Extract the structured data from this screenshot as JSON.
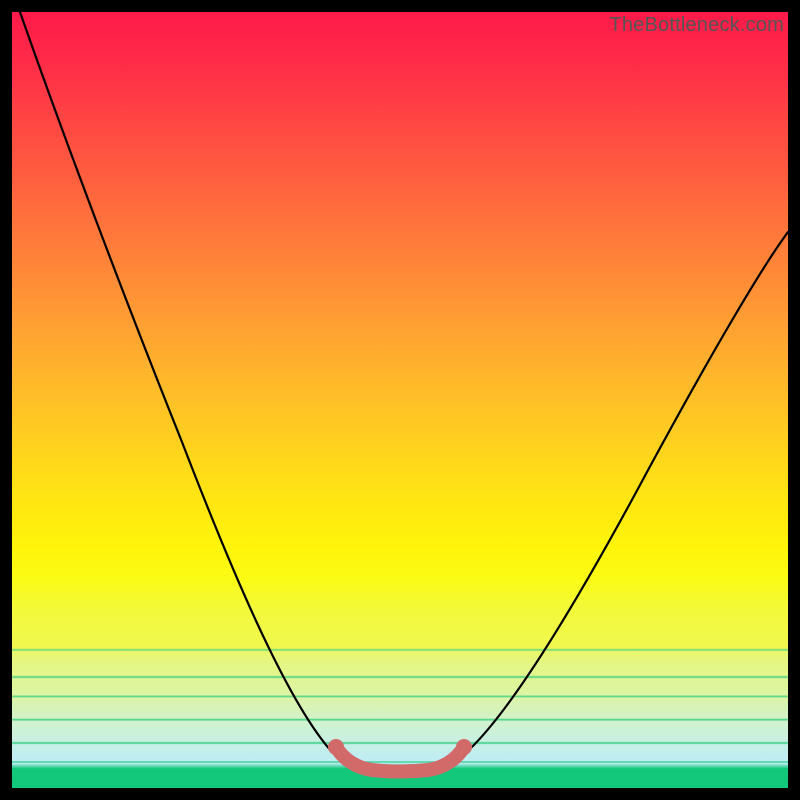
{
  "watermark": "TheBottleneck.com",
  "chart_data": {
    "type": "line",
    "title": "",
    "xlabel": "",
    "ylabel": "",
    "xlim": [
      0,
      100
    ],
    "ylim": [
      0,
      100
    ],
    "grid": false,
    "series": [
      {
        "name": "bottleneck-curve",
        "x": [
          0,
          6,
          12,
          18,
          24,
          30,
          34,
          38,
          41,
          44,
          47,
          50,
          53,
          56,
          60,
          66,
          72,
          78,
          84,
          90,
          96,
          100
        ],
        "y": [
          100,
          88,
          76,
          64,
          52,
          40,
          32,
          24,
          16,
          8,
          3,
          2,
          3,
          8,
          16,
          26,
          36,
          45,
          54,
          62,
          69,
          74
        ]
      },
      {
        "name": "optimal-zone-highlight",
        "x": [
          43,
          44,
          46,
          48,
          50,
          52,
          54,
          56,
          57
        ],
        "y": [
          8,
          6,
          3,
          2,
          2,
          2,
          3,
          6,
          8
        ]
      }
    ],
    "annotations": [],
    "colors": {
      "curve": "#000000",
      "highlight": "#d26a6a",
      "gradient_top": "#ff1a49",
      "gradient_mid": "#fff40a",
      "gradient_bottom": "#14c87b"
    }
  }
}
